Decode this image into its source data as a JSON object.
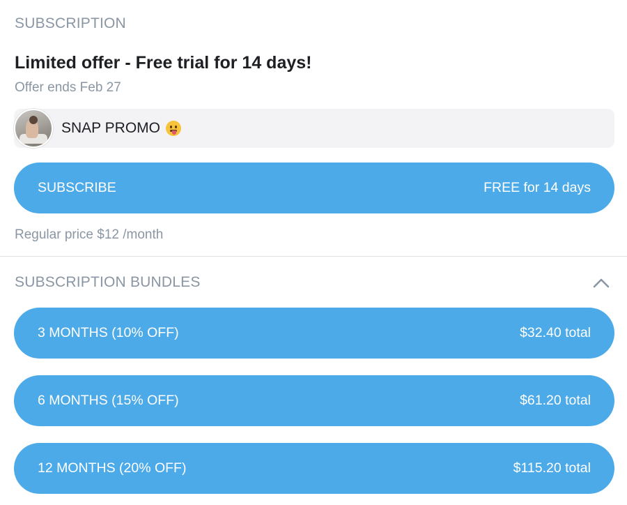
{
  "subscription": {
    "title": "SUBSCRIPTION",
    "offer_title": "Limited offer - Free trial for 14 days!",
    "offer_ends": "Offer ends Feb 27",
    "promo_name": "SNAP PROMO",
    "promo_emoji": "face-with-tongue-emoji",
    "subscribe_label": "SUBSCRIBE",
    "subscribe_price": "FREE for 14 days",
    "regular_price": "Regular price $12 /month"
  },
  "bundles": {
    "title": "SUBSCRIPTION BUNDLES",
    "collapse_icon": "chevron-up-icon",
    "items": [
      {
        "label": "3 MONTHS (10% off)",
        "price": "$32.40 total"
      },
      {
        "label": "6 MONTHS (15% off)",
        "price": "$61.20 total"
      },
      {
        "label": "12 MONTHS (20% off)",
        "price": "$115.20 total"
      }
    ]
  },
  "colors": {
    "accent": "#4daae8",
    "muted_text": "#8a96a3",
    "text": "#1e1f23",
    "card_bg": "#f3f3f6"
  }
}
